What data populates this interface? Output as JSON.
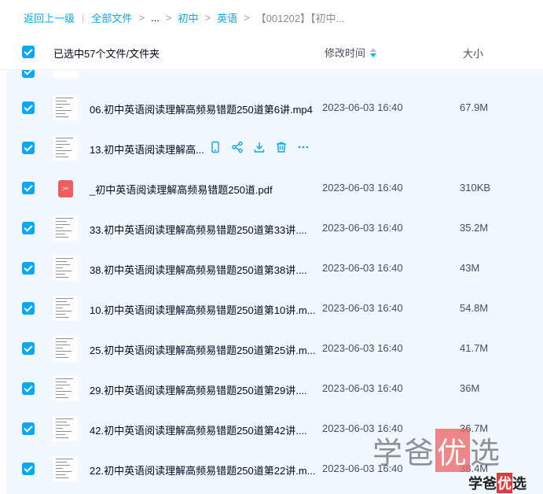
{
  "breadcrumb": {
    "back": "返回上一级",
    "all_files": "全部文件",
    "ellipsis": "...",
    "level1": "初中",
    "level2": "英语",
    "current": "【001202】【初中..."
  },
  "header": {
    "selected_text": "已选中57个文件/文件夹",
    "modified_label": "修改时间",
    "size_label": "大小"
  },
  "files": [
    {
      "name": "06.初中英语阅读理解高频易错题250道第6讲.mp4",
      "time": "2023-06-03 16:40",
      "size": "67.9M",
      "type": "video"
    },
    {
      "name": "13.初中英语阅读理解高...",
      "time": "",
      "size": "",
      "type": "video",
      "hover": true
    },
    {
      "name": "_初中英语阅读理解高频易错题250道.pdf",
      "time": "2023-06-03 16:40",
      "size": "310KB",
      "type": "pdf"
    },
    {
      "name": "33.初中英语阅读理解高频易错题250道第33讲....",
      "time": "2023-06-03 16:40",
      "size": "35.2M",
      "type": "video"
    },
    {
      "name": "38.初中英语阅读理解高频易错题250道第38讲....",
      "time": "2023-06-03 16:40",
      "size": "43M",
      "type": "video"
    },
    {
      "name": "10.初中英语阅读理解高频易错题250道第10讲.m...",
      "time": "2023-06-03 16:40",
      "size": "54.8M",
      "type": "video"
    },
    {
      "name": "25.初中英语阅读理解高频易错题250道第25讲.m...",
      "time": "2023-06-03 16:40",
      "size": "41.7M",
      "type": "video"
    },
    {
      "name": "29.初中英语阅读理解高频易错题250道第29讲....",
      "time": "2023-06-03 16:40",
      "size": "36M",
      "type": "video"
    },
    {
      "name": "42.初中英语阅读理解高频易错题250道第42讲....",
      "time": "2023-06-03 16:40",
      "size": "36.7M",
      "type": "video"
    },
    {
      "name": "22.初中英语阅读理解高频易错题250道第22讲.m...",
      "time": "2023-06-03 16:40",
      "size": "38.4M",
      "type": "video"
    }
  ],
  "hover_actions": [
    "phone-icon",
    "share-icon",
    "download-icon",
    "delete-icon",
    "more-icon"
  ],
  "watermark": {
    "big_a": "学爸",
    "big_b": "优",
    "big_c": "选",
    "small_a": "学爸",
    "small_b": "优",
    "small_c": "选"
  },
  "colors": {
    "accent": "#06a7ff",
    "selected_row_bg": "#f1f8ff",
    "pdf": "#f25c5c"
  }
}
